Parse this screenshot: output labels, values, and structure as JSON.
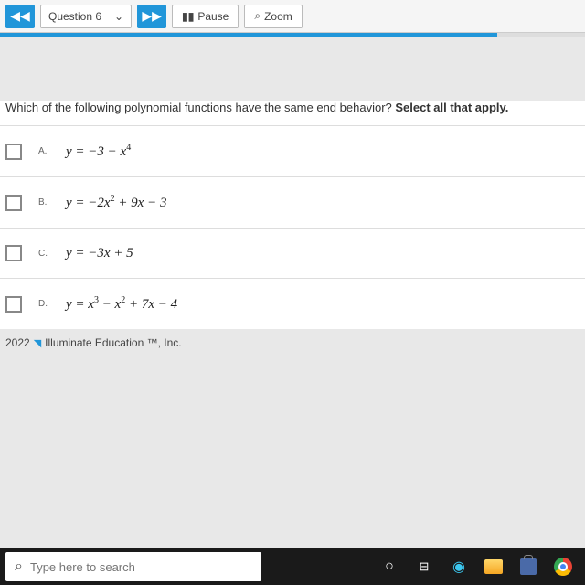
{
  "toolbar": {
    "question_label": "Question 6",
    "pause_label": "Pause",
    "zoom_label": "Zoom"
  },
  "question": {
    "prompt_plain": "Which of the following polynomial functions have the same end behavior? ",
    "prompt_bold": "Select all that apply."
  },
  "options": [
    {
      "letter": "A.",
      "formula_html": "y = −3 − x<sup>4</sup>"
    },
    {
      "letter": "B.",
      "formula_html": "y = −2x<sup>2</sup> + 9x − 3"
    },
    {
      "letter": "C.",
      "formula_html": "y = −3x + 5"
    },
    {
      "letter": "D.",
      "formula_html": "y = x<sup>3</sup> − x<sup>2</sup> + 7x − 4"
    }
  ],
  "footer": {
    "year": "2022",
    "brand": "Illuminate Education ™, Inc."
  },
  "taskbar": {
    "search_placeholder": "Type here to search"
  }
}
